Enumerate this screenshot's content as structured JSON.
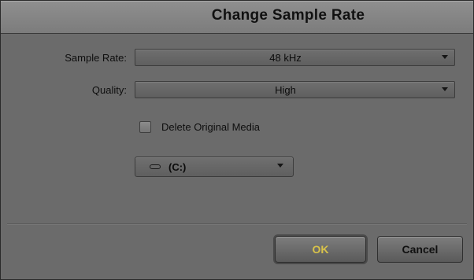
{
  "dialog": {
    "title": "Change Sample Rate"
  },
  "sample_rate": {
    "label": "Sample Rate:",
    "value": "48 kHz"
  },
  "quality": {
    "label": "Quality:",
    "value": "High"
  },
  "delete_original": {
    "label": "Delete Original Media",
    "checked": false
  },
  "drive": {
    "value": "(C:)",
    "icon": "drive-icon"
  },
  "buttons": {
    "ok": "OK",
    "cancel": "Cancel"
  },
  "colors": {
    "ok_text": "#d8c24a",
    "dialog_bg": "#6b6b6b"
  }
}
